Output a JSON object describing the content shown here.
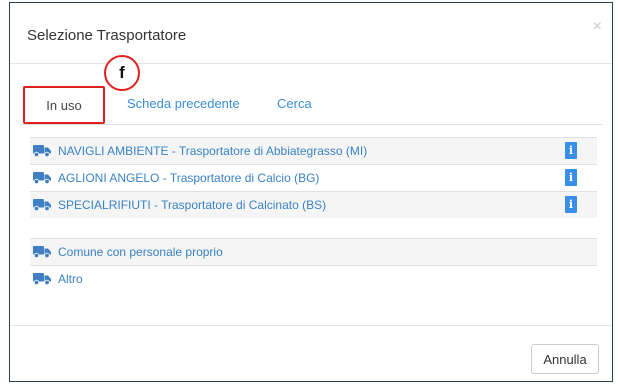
{
  "dialog": {
    "title": "Selezione Trasportatore",
    "close_glyph": "×"
  },
  "marker": {
    "label": "f"
  },
  "tabs": [
    {
      "label": "In uso",
      "active": true
    },
    {
      "label": "Scheda precedente",
      "active": false
    },
    {
      "label": "Cerca",
      "active": false
    }
  ],
  "transporters": [
    {
      "label": "NAVIGLI AMBIENTE - Trasportatore di Abbiategrasso (MI)",
      "icon": "truck-icon",
      "info_glyph": "i"
    },
    {
      "label": "AGLIONI ANGELO - Trasportatore di Calcio (BG)",
      "icon": "truck-icon",
      "info_glyph": "i"
    },
    {
      "label": "SPECIALRIFIUTI - Trasportatore di Calcinato (BS)",
      "icon": "truck-icon",
      "info_glyph": "i"
    }
  ],
  "other_options": [
    {
      "label": "Comune con personale proprio",
      "icon": "truck-icon"
    },
    {
      "label": "Altro",
      "icon": "truck-icon"
    }
  ],
  "footer": {
    "cancel_label": "Annulla"
  },
  "colors": {
    "link": "#3a82c4",
    "truck_icon": "#3f7fc3",
    "info_button": "#3b8ee6",
    "annotation_red": "#e02020",
    "modal_border": "#2c3e50"
  }
}
